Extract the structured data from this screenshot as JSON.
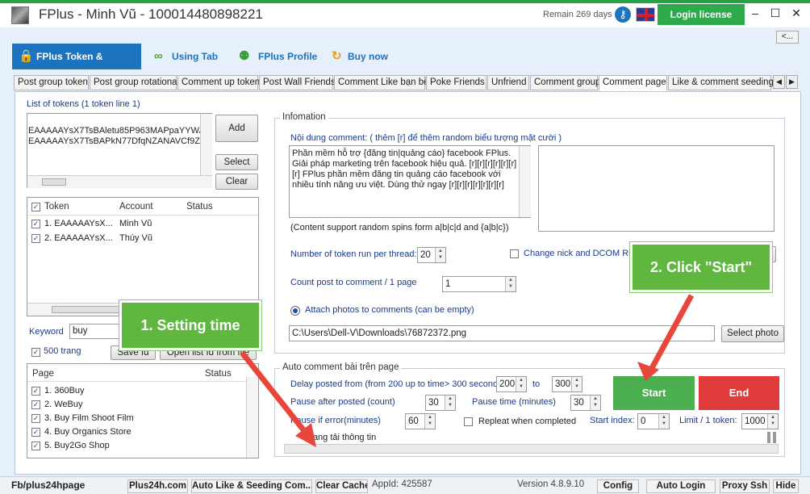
{
  "window": {
    "title": "FPlus - Minh Vũ - 100014480898221",
    "remain": "Remain 269 days",
    "login_label": "Login license",
    "minimize": "–",
    "maximize": "☐",
    "close": "✕",
    "back_label": "<..."
  },
  "main_tabs": [
    {
      "label": "FPlus Token & Cookie"
    },
    {
      "label": "Using Tab"
    },
    {
      "label": "FPlus Profile"
    },
    {
      "label": "Buy now"
    }
  ],
  "sub_tabs": [
    "Post group token",
    "Post group rotational",
    "Comment up token",
    "Post Wall Friends",
    "Comment Like bạn bè",
    "Poke Friends",
    "Unfriend",
    "Comment group",
    "Comment page",
    "Like & comment seeding"
  ],
  "tokens": {
    "title": "List of tokens (1 token line 1)",
    "lines": [
      "EAAAAAYsX7TsBAletu85P963MAPpaYYW/",
      "EAAAAAYsX7TsBAPkN77DfqNZANAVCf9Z"
    ],
    "add": "Add",
    "select": "Select",
    "clear": "Clear",
    "columns": [
      "Token",
      "Account",
      "Status"
    ],
    "rows": [
      {
        "token": "1. EAAAAAYsX...",
        "account": "Minh Vũ",
        "status": ""
      },
      {
        "token": "2. EAAAAAYsX...",
        "account": "Thúy Vũ",
        "status": ""
      }
    ]
  },
  "keyword": {
    "label": "Keyword",
    "value": "buy",
    "pages_label": "500 trang",
    "save_id": "Save Id",
    "open_list": "Open list Id from file"
  },
  "pages": {
    "columns": [
      "Page",
      "Status"
    ],
    "rows": [
      "1. 360Buy",
      "2. WeBuy",
      "3. Buy Film Shoot Film",
      "4. Buy Organics Store",
      "5. Buy2Go Shop"
    ]
  },
  "info": {
    "title": "Infomation",
    "content_label": "Nội dung comment: ( thêm [r] để thêm random biểu tượng mặt cười )",
    "content_lines": [
      "Phần mềm hỗ trợ {đăng tin|quảng cáo} facebook FPlus.",
      "Giải pháp marketing trên facebook hiệu quả. [r][r][r][r][r][r]",
      "[r] FPlus phần mềm đăng tin quảng cáo facebook với",
      "nhiều tính năng ưu việt. Dùng thử ngay [r][r][r][r][r][r][r]"
    ],
    "spin_note": "(Content support random spins form a|b|c|d and {a|b|c})",
    "token_thread_label": "Number of token run per thread:",
    "token_thread_value": "20",
    "change_nick_label": "Change nick and DCOM Re",
    "count_post_label": "Count post to comment / 1 page",
    "count_post_value": "1",
    "attach_label": "Attach photos to comments (can be empty)",
    "photo_path": "C:\\Users\\Dell-V\\Downloads\\76872372.png",
    "select_photo": "Select photo"
  },
  "auto": {
    "title": "Auto comment bài trên page",
    "delay_label": "Delay posted from (from 200 up to time> 300 seconds)",
    "delay_from": "200",
    "to_label": "to",
    "delay_to": "300",
    "pause_after_label": "Pause after posted (count)",
    "pause_after_value": "30",
    "pause_time_label": "Pause time (minutes)",
    "pause_time_value": "30",
    "pause_error_label": "Pause if error(minutes)",
    "pause_error_value": "60",
    "repeat_label": "Repleat when completed",
    "start_index_label": "Start index:",
    "start_index_value": "0",
    "limit_label": "Limit / 1 token:",
    "limit_value": "1000",
    "status": "Đang tải thông tin",
    "start": "Start",
    "end": "End"
  },
  "callouts": {
    "setting_time": "1. Setting time",
    "click_start": "2. Click \"Start\""
  },
  "statusbar": {
    "fb_link": "Fb/plus24hpage",
    "plus24h": "Plus24h.com",
    "auto_like": "Auto Like & Seeding Com...",
    "clear_cache": "Clear Cache",
    "appid": "AppId: 425587",
    "version": "Version 4.8.9.10",
    "config": "Config",
    "auto_login": "Auto Login",
    "proxy": "Proxy Ssh",
    "hide": "Hide"
  },
  "colors": {
    "accent": "#1e73be",
    "green": "#2eaa4c",
    "start": "#4caf50",
    "end": "#e03c3c",
    "callout": "#5fb73f",
    "arrow": "#e8463a"
  },
  "icons": [
    "key-icon",
    "uk-flag-icon",
    "token-icon",
    "using-tab-icon",
    "profile-icon",
    "buy-now-icon"
  ]
}
